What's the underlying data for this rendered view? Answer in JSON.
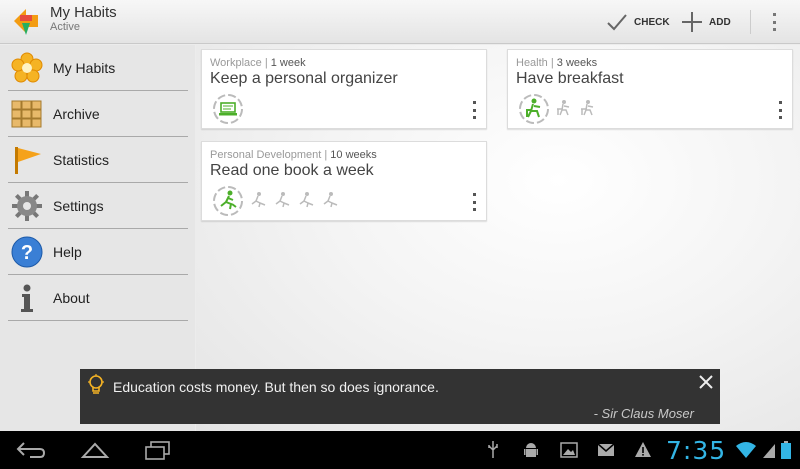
{
  "actionbar": {
    "title": "My Habits",
    "subtitle": "Active",
    "check_label": "CHECK",
    "add_label": "ADD"
  },
  "sidebar": {
    "items": [
      {
        "label": "My Habits",
        "icon": "flower-icon"
      },
      {
        "label": "Archive",
        "icon": "archive-icon"
      },
      {
        "label": "Statistics",
        "icon": "flag-icon"
      },
      {
        "label": "Settings",
        "icon": "gear-icon"
      },
      {
        "label": "Help",
        "icon": "help-icon"
      },
      {
        "label": "About",
        "icon": "info-icon"
      }
    ]
  },
  "habits": [
    {
      "category": "Workplace",
      "duration": "1 week",
      "title": "Keep a personal organizer",
      "icon": "laptop-icon",
      "days_shown": 1
    },
    {
      "category": "Health",
      "duration": "3 weeks",
      "title": "Have breakfast",
      "icon": "breakfast-icon",
      "days_shown": 3
    },
    {
      "category": "Personal Development",
      "duration": "10 weeks",
      "title": "Read one book a week",
      "icon": "reading-icon",
      "days_shown": 5
    }
  ],
  "quote": {
    "text": "Education costs money.  But then so does ignorance.",
    "author": "- Sir Claus Moser"
  },
  "statusbar": {
    "time": "7:35"
  },
  "colors": {
    "accent_green": "#4caf2a",
    "clock_blue": "#33b5e5",
    "brand_orange": "#f39c12"
  }
}
